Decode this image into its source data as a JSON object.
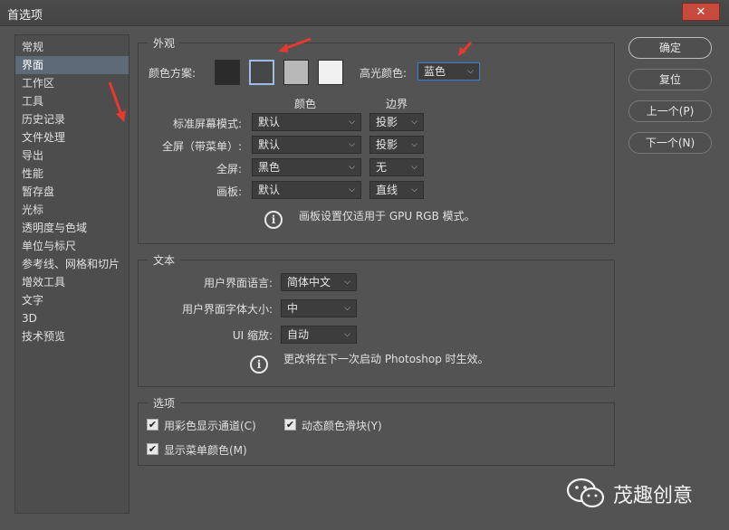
{
  "window": {
    "title": "首选项",
    "close_symbol": "✕"
  },
  "sidebar": {
    "items": [
      "常规",
      "界面",
      "工作区",
      "工具",
      "历史记录",
      "文件处理",
      "导出",
      "性能",
      "暂存盘",
      "光标",
      "透明度与色域",
      "单位与标尺",
      "参考线、网格和切片",
      "增效工具",
      "文字",
      "3D",
      "技术预览"
    ],
    "active_index": 1
  },
  "appearance": {
    "group_title": "外观",
    "scheme_label": "颜色方案:",
    "swatch_colors": [
      "#2b2b2b",
      "#464646",
      "#b8b8b8",
      "#f0f0f0"
    ],
    "selected_swatch": 1,
    "highlight_label": "高光颜色:",
    "highlight_value": "蓝色",
    "col_color": "颜色",
    "col_border": "边界",
    "rows": [
      {
        "label": "标准屏幕模式:",
        "color": "默认",
        "border": "投影"
      },
      {
        "label": "全屏（带菜单）:",
        "color": "默认",
        "border": "投影"
      },
      {
        "label": "全屏:",
        "color": "黑色",
        "border": "无"
      },
      {
        "label": "画板:",
        "color": "默认",
        "border": "直线"
      }
    ],
    "info_text": "画板设置仅适用于 GPU RGB 模式。"
  },
  "text_group": {
    "group_title": "文本",
    "ui_language_label": "用户界面语言:",
    "ui_language_value": "简体中文",
    "ui_fontsize_label": "用户界面字体大小:",
    "ui_fontsize_value": "中",
    "ui_scale_label": "UI 缩放:",
    "ui_scale_value": "自动",
    "info_text": "更改将在下一次启动 Photoshop 时生效。"
  },
  "options": {
    "group_title": "选项",
    "checks": [
      {
        "label": "用彩色显示通道(C)",
        "checked": true
      },
      {
        "label": "动态颜色滑块(Y)",
        "checked": true
      },
      {
        "label": "显示菜单颜色(M)",
        "checked": true
      }
    ]
  },
  "buttons": {
    "ok": "确定",
    "reset": "复位",
    "prev": "上一个(P)",
    "next": "下一个(N)"
  },
  "watermark": {
    "text": "茂趣创意"
  },
  "colors": {
    "accent_arrow": "#e8392e",
    "highlight_border": "#3d7fd6"
  }
}
